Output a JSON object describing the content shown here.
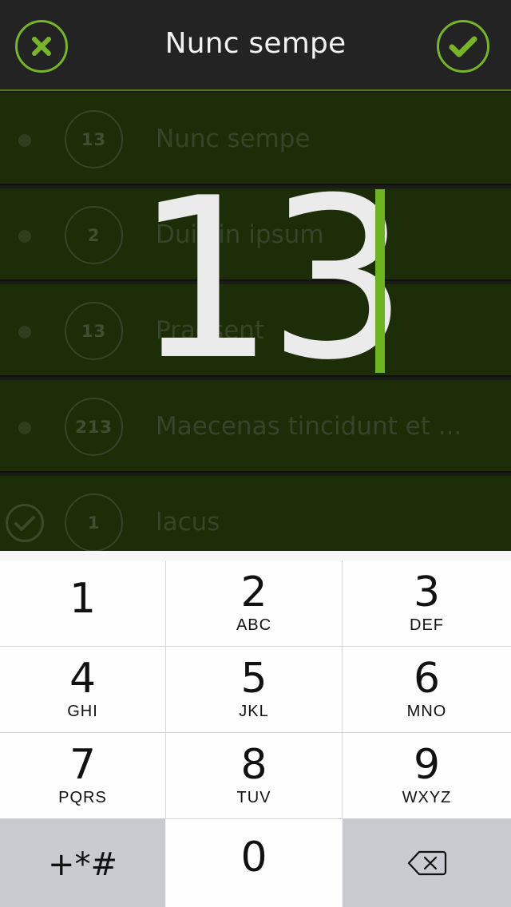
{
  "header": {
    "title": "Nunc sempe",
    "cancel_icon": "close-icon",
    "confirm_icon": "checkmark-icon",
    "accent_color": "#78b42a"
  },
  "entry": {
    "value": "13"
  },
  "list": {
    "rows": [
      {
        "count": "13",
        "title": "Nunc sempe",
        "state": "open"
      },
      {
        "count": "2",
        "title": "Duis in ipsum",
        "state": "open"
      },
      {
        "count": "13",
        "title": "Praesent",
        "state": "open"
      },
      {
        "count": "213",
        "title": "Maecenas tincidunt et ...",
        "state": "open"
      },
      {
        "count": "1",
        "title": "lacus",
        "state": "done"
      }
    ]
  },
  "keypad": {
    "keys": [
      {
        "num": "1",
        "letters": ""
      },
      {
        "num": "2",
        "letters": "ABC"
      },
      {
        "num": "3",
        "letters": "DEF"
      },
      {
        "num": "4",
        "letters": "GHI"
      },
      {
        "num": "5",
        "letters": "JKL"
      },
      {
        "num": "6",
        "letters": "MNO"
      },
      {
        "num": "7",
        "letters": "PQRS"
      },
      {
        "num": "8",
        "letters": "TUV"
      },
      {
        "num": "9",
        "letters": "WXYZ"
      }
    ],
    "symbols_label": "+*#",
    "zero": "0",
    "delete_icon": "backspace-icon"
  }
}
